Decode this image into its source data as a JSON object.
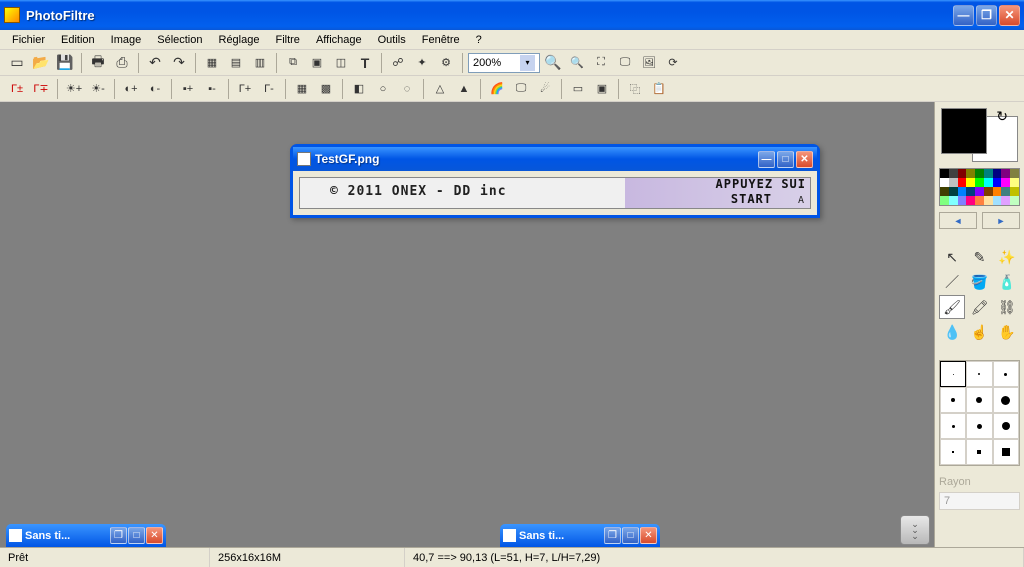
{
  "app": {
    "title": "PhotoFiltre"
  },
  "menu": [
    "Fichier",
    "Edition",
    "Image",
    "Sélection",
    "Réglage",
    "Filtre",
    "Affichage",
    "Outils",
    "Fenêtre",
    "?"
  ],
  "zoom": {
    "value": "200%"
  },
  "document": {
    "title": "TestGF.png",
    "canvas_text_left": "© 2011 ONEX - DD inc",
    "canvas_text_r1": "APPUYEZ SUI",
    "canvas_text_r2": "START",
    "canvas_text_r3": "A"
  },
  "min_docs": [
    {
      "label": "Sans ti..."
    },
    {
      "label": "Sans ti..."
    }
  ],
  "palette": {
    "fg": "#000000",
    "bg": "#ffffff",
    "colors": [
      "#000000",
      "#404040",
      "#800000",
      "#808000",
      "#008000",
      "#008080",
      "#000080",
      "#800080",
      "#808040",
      "#ffffff",
      "#c0c0c0",
      "#ff0000",
      "#ffff00",
      "#00ff00",
      "#00ffff",
      "#0000ff",
      "#ff00ff",
      "#ffff80",
      "#404000",
      "#004040",
      "#0080ff",
      "#004080",
      "#8000ff",
      "#804000",
      "#ff8000",
      "#408080",
      "#c0c000",
      "#80ff80",
      "#80ffff",
      "#8080ff",
      "#ff0080",
      "#ff8040",
      "#ffe0a0",
      "#a0e0ff",
      "#e0a0ff",
      "#c0ffc0"
    ]
  },
  "brushes": {
    "sizes": [
      1,
      2,
      3,
      4,
      6,
      9,
      3,
      5,
      8,
      2,
      4,
      8
    ],
    "rayon_label": "Rayon",
    "rayon_value": "7"
  },
  "status": {
    "ready": "Prêt",
    "dims": "256x16x16M",
    "coords": "40,7 ==> 90,13 (L=51, H=7, L/H=7,29)"
  }
}
